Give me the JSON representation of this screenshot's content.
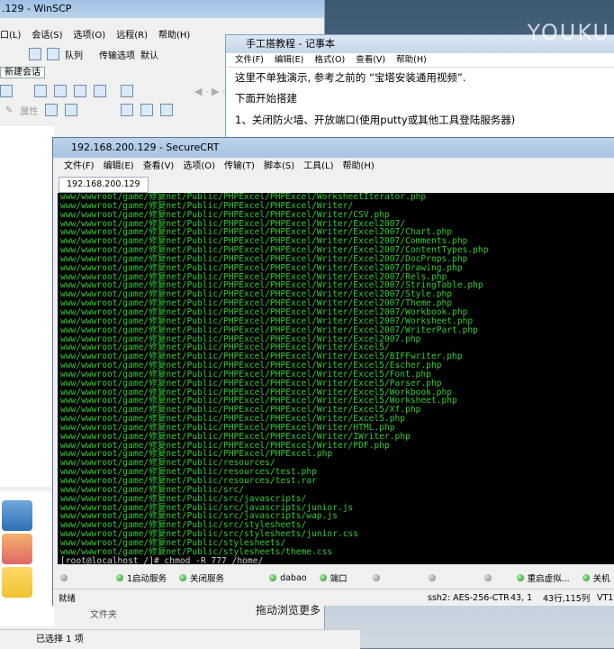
{
  "winscp": {
    "title": ".129 - WinSCP",
    "menu": [
      "口(L)",
      "会话(S)",
      "选项(O)",
      "远程(R)",
      "帮助(H)"
    ],
    "toolbar": {
      "queue": "队列",
      "transfer_options": "传输选项",
      "default": "默认"
    },
    "tab": "新建会话",
    "prop": "属性",
    "status": "已选择 1 项",
    "folder": "文件夹"
  },
  "notepad": {
    "title": "手工搭教程 - 记事本",
    "menu": [
      "文件(F)",
      "编辑(E)",
      "格式(O)",
      "查看(V)",
      "帮助(H)"
    ],
    "lines": [
      "这里不单独演示, 参考之前的 “宝塔安装通用视频”.",
      "下面开始搭建",
      "1、关闭防火墙、开放端口(使用putty或其他工具登陆服务器)"
    ]
  },
  "securecrt": {
    "title": "192.168.200.129 - SecureCRT",
    "menu": [
      "文件(F)",
      "编辑(E)",
      "查看(V)",
      "选项(O)",
      "传输(T)",
      "脚本(S)",
      "工具(L)",
      "帮助(H)"
    ],
    "tab": "192.168.200.129",
    "terminal_lines": [
      "www/wwwroot/game/修复net/Public/PHPExcel/PHPExcel/WorksheetIterator.php",
      "www/wwwroot/game/修复net/Public/PHPExcel/PHPExcel/Writer/",
      "www/wwwroot/game/修复net/Public/PHPExcel/PHPExcel/Writer/CSV.php",
      "www/wwwroot/game/修复net/Public/PHPExcel/PHPExcel/Writer/Excel2007/",
      "www/wwwroot/game/修复net/Public/PHPExcel/PHPExcel/Writer/Excel2007/Chart.php",
      "www/wwwroot/game/修复net/Public/PHPExcel/PHPExcel/Writer/Excel2007/Comments.php",
      "www/wwwroot/game/修复net/Public/PHPExcel/PHPExcel/Writer/Excel2007/ContentTypes.php",
      "www/wwwroot/game/修复net/Public/PHPExcel/PHPExcel/Writer/Excel2007/DocProps.php",
      "www/wwwroot/game/修复net/Public/PHPExcel/PHPExcel/Writer/Excel2007/Drawing.php",
      "www/wwwroot/game/修复net/Public/PHPExcel/PHPExcel/Writer/Excel2007/Rels.php",
      "www/wwwroot/game/修复net/Public/PHPExcel/PHPExcel/Writer/Excel2007/StringTable.php",
      "www/wwwroot/game/修复net/Public/PHPExcel/PHPExcel/Writer/Excel2007/Style.php",
      "www/wwwroot/game/修复net/Public/PHPExcel/PHPExcel/Writer/Excel2007/Theme.php",
      "www/wwwroot/game/修复net/Public/PHPExcel/PHPExcel/Writer/Excel2007/Workbook.php",
      "www/wwwroot/game/修复net/Public/PHPExcel/PHPExcel/Writer/Excel2007/Worksheet.php",
      "www/wwwroot/game/修复net/Public/PHPExcel/PHPExcel/Writer/Excel2007/WriterPart.php",
      "www/wwwroot/game/修复net/Public/PHPExcel/PHPExcel/Writer/Excel2007.php",
      "www/wwwroot/game/修复net/Public/PHPExcel/PHPExcel/Writer/Excel5/",
      "www/wwwroot/game/修复net/Public/PHPExcel/PHPExcel/Writer/Excel5/BIFFwriter.php",
      "www/wwwroot/game/修复net/Public/PHPExcel/PHPExcel/Writer/Excel5/Escher.php",
      "www/wwwroot/game/修复net/Public/PHPExcel/PHPExcel/Writer/Excel5/Font.php",
      "www/wwwroot/game/修复net/Public/PHPExcel/PHPExcel/Writer/Excel5/Parser.php",
      "www/wwwroot/game/修复net/Public/PHPExcel/PHPExcel/Writer/Excel5/Workbook.php",
      "www/wwwroot/game/修复net/Public/PHPExcel/PHPExcel/Writer/Excel5/Worksheet.php",
      "www/wwwroot/game/修复net/Public/PHPExcel/PHPExcel/Writer/Excel5/Xf.php",
      "www/wwwroot/game/修复net/Public/PHPExcel/PHPExcel/Writer/Excel5.php",
      "www/wwwroot/game/修复net/Public/PHPExcel/PHPExcel/Writer/HTML.php",
      "www/wwwroot/game/修复net/Public/PHPExcel/PHPExcel/Writer/IWriter.php",
      "www/wwwroot/game/修复net/Public/PHPExcel/PHPExcel/Writer/PDF.php",
      "www/wwwroot/game/修复net/Public/PHPExcel/PHPExcel.php",
      "www/wwwroot/game/修复net/Public/resources/",
      "www/wwwroot/game/修复net/Public/resources/test.php",
      "www/wwwroot/game/修复net/Public/resources/test.rar",
      "www/wwwroot/game/修复net/Public/src/",
      "www/wwwroot/game/修复net/Public/src/javascripts/",
      "www/wwwroot/game/修复net/Public/src/javascripts/junior.js",
      "www/wwwroot/game/修复net/Public/src/javascripts/wap.js",
      "www/wwwroot/game/修复net/Public/src/stylesheets/",
      "www/wwwroot/game/修复net/Public/src/stylesheets/junior.css",
      "www/wwwroot/game/修复net/Public/stylesheets/",
      "www/wwwroot/game/修复net/Public/stylesheets/theme.css"
    ],
    "prompt": "[root@localhost /]# chmod -R 777 /home/",
    "buttons": [
      "1启动服务",
      "关闭服务",
      "",
      "dabao",
      "端口",
      "",
      "",
      "",
      "重启虚拟...",
      "关机"
    ],
    "status": {
      "left": "就绪",
      "cipher": "ssh2: AES-256-CTR",
      "cursor": "43, 1",
      "size": "43行,115列",
      "term": "VT1"
    }
  },
  "overlay": {
    "watermark": "YOUKU",
    "subtitle": "拖动浏览更多"
  }
}
